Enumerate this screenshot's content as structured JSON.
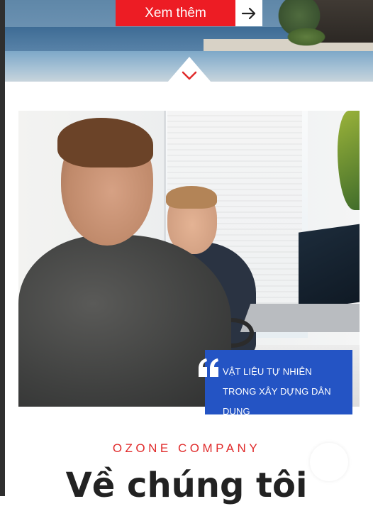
{
  "hero": {
    "cta_label": "Xem thêm",
    "arrow_icon": "arrow-right-icon",
    "scroll_icon": "chevron-down-icon"
  },
  "feature": {
    "quote_icon": "quote-icon",
    "quote_text": "VẬT LIỆU TỰ NHIÊN TRONG XÂY DỰNG DÂN DỤNG"
  },
  "about": {
    "eyebrow": "OZONE COMPANY",
    "title": "Về chúng tôi"
  },
  "colors": {
    "accent_red": "#ed1c24",
    "quote_blue": "#2454c4",
    "eyebrow_red": "#e02a2a",
    "heading": "#222222"
  }
}
